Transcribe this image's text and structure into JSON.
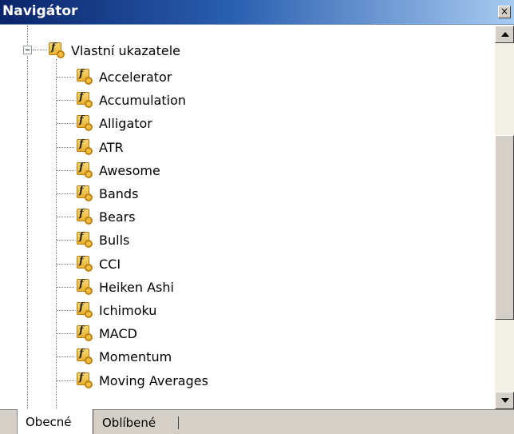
{
  "window": {
    "title": "Navigátor",
    "close_label": "×"
  },
  "tree": {
    "root": {
      "label": "Vlastní ukazatele",
      "icon": "custom-indicator-icon",
      "expanded": true
    },
    "items": [
      {
        "label": "Accelerator"
      },
      {
        "label": "Accumulation"
      },
      {
        "label": "Alligator"
      },
      {
        "label": "ATR"
      },
      {
        "label": "Awesome"
      },
      {
        "label": "Bands"
      },
      {
        "label": "Bears"
      },
      {
        "label": "Bulls"
      },
      {
        "label": "CCI"
      },
      {
        "label": "Heiken Ashi"
      },
      {
        "label": "Ichimoku"
      },
      {
        "label": "MACD"
      },
      {
        "label": "Momentum"
      },
      {
        "label": "Moving Averages"
      }
    ]
  },
  "tabs": [
    {
      "label": "Obecné",
      "active": true
    },
    {
      "label": "Oblíbené",
      "active": false
    }
  ],
  "colors": {
    "titlebar_start": "#0a246a",
    "titlebar_end": "#a6caf0",
    "icon_fill": "#f0c040"
  }
}
